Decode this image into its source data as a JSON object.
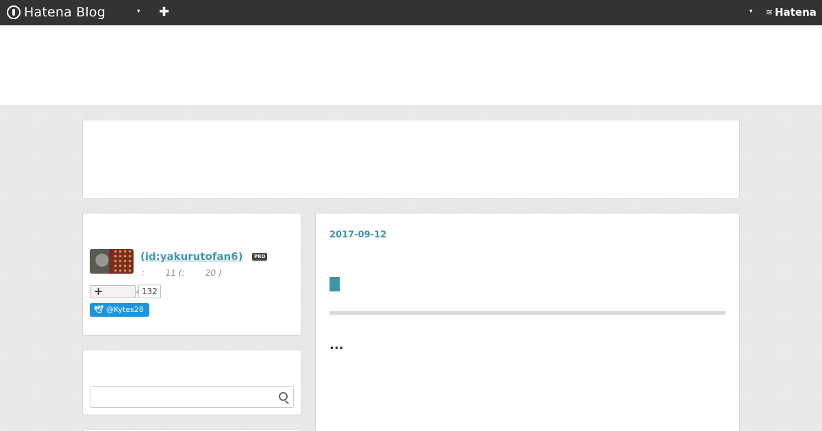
{
  "topbar": {
    "logo_text": "Hatena Blog",
    "logo_icon": "hatena-blog-logo-icon",
    "menu_dropdown_icon": "▾",
    "add_icon": "✚",
    "account_dropdown_icon": "▾",
    "brand_text": "Hatena",
    "brand_icon": "hatena-wave-icon"
  },
  "profile": {
    "name": " (id:yakurutofan6)",
    "badge": "PRO",
    "meta": ":        11 (:        20 )",
    "follow_icon": "+",
    "follow_count": "132",
    "twitter_handle": "@Kytes28",
    "twitter_icon": "twitter-bird-icon"
  },
  "search": {
    "placeholder": "",
    "icon": "search-icon"
  },
  "article": {
    "date": "2017-09-12",
    "more": "..."
  },
  "colors": {
    "topbar": "#333333",
    "accent": "#3c96a8",
    "twitter": "#1b95e0",
    "background": "#ebebeb"
  }
}
